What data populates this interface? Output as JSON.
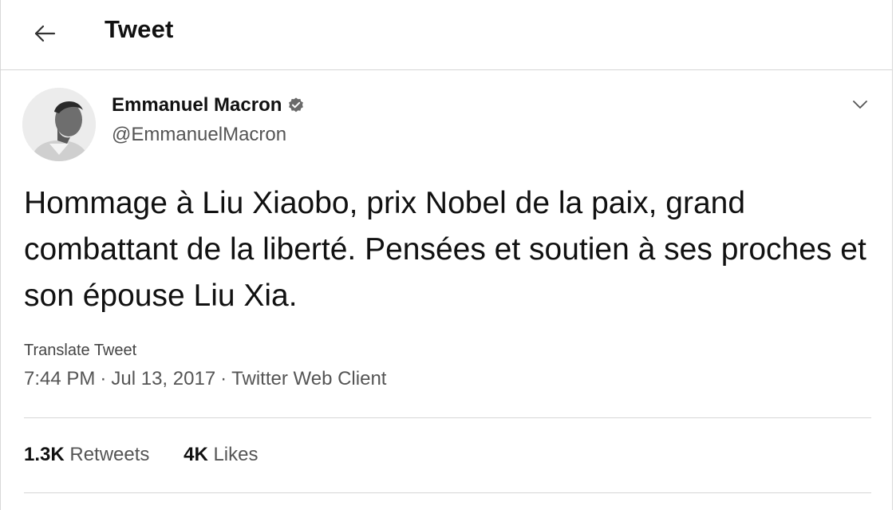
{
  "header": {
    "title": "Tweet",
    "back_icon": "arrow-left-icon"
  },
  "author": {
    "name": "Emmanuel Macron",
    "handle": "@EmmanuelMacron",
    "verified_icon": "verified-badge-icon"
  },
  "tweet": {
    "text": "Hommage à Liu Xiaobo, prix Nobel de la paix, grand combattant de la liberté. Pensées et soutien à ses proches et son épouse Liu Xia.",
    "translate_label": "Translate Tweet",
    "time": "7:44 PM",
    "date": "Jul 13, 2017",
    "separator": "·",
    "client": "Twitter Web Client"
  },
  "stats": {
    "retweets_count": "1.3K",
    "retweets_label": "Retweets",
    "likes_count": "4K",
    "likes_label": "Likes"
  },
  "menu": {
    "caret_icon": "chevron-down-icon"
  }
}
